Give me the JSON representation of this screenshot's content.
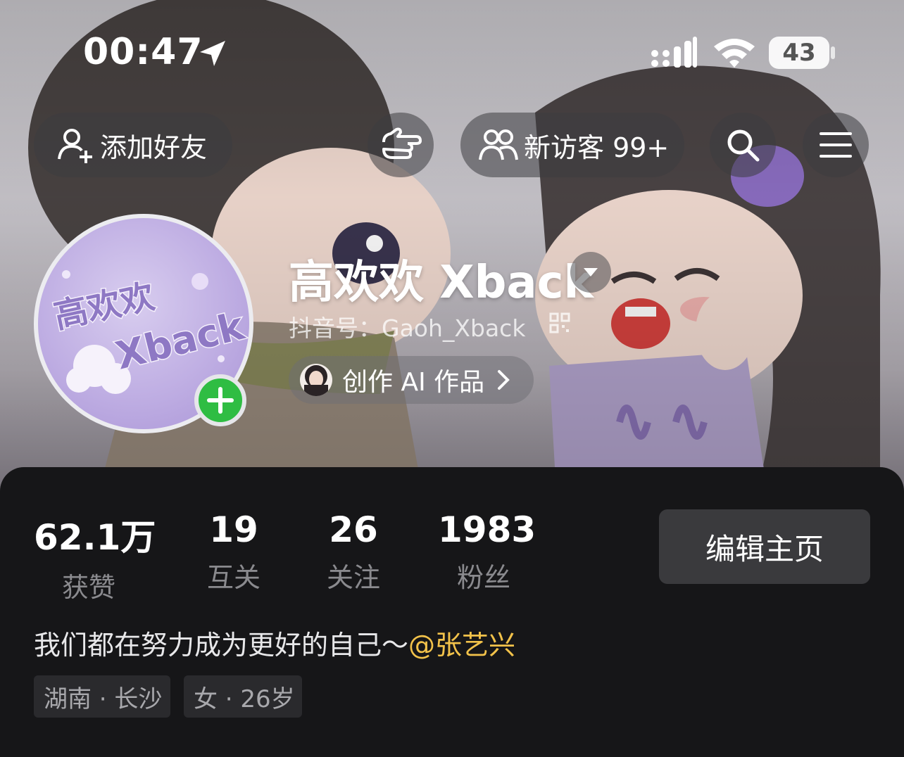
{
  "status_bar": {
    "time": "00:47",
    "battery": "43"
  },
  "top_bar": {
    "add_friend_label": "添加好友",
    "visitor_label": "新访客 99+"
  },
  "profile": {
    "nickname": "高欢欢 Xback",
    "douyin_id": "抖音号：Gaoh_Xback",
    "ai_label": "创作 AI 作品",
    "avatar_text": [
      "高欢欢",
      "Xback"
    ]
  },
  "stats": [
    {
      "value": "62.1万",
      "label": "获赞"
    },
    {
      "value": "19",
      "label": "互关"
    },
    {
      "value": "26",
      "label": "关注"
    },
    {
      "value": "1983",
      "label": "粉丝"
    }
  ],
  "edit_button_label": "编辑主页",
  "bio": {
    "text": "我们都在努力成为更好的自己～",
    "mention": "@张艺兴"
  },
  "tags": [
    {
      "label": "湖南 · 长沙"
    },
    {
      "label": "女 · 26岁"
    }
  ],
  "colors": {
    "mention": "#f2c24a",
    "plus_badge": "#2fbd43",
    "panel": "#161618"
  }
}
